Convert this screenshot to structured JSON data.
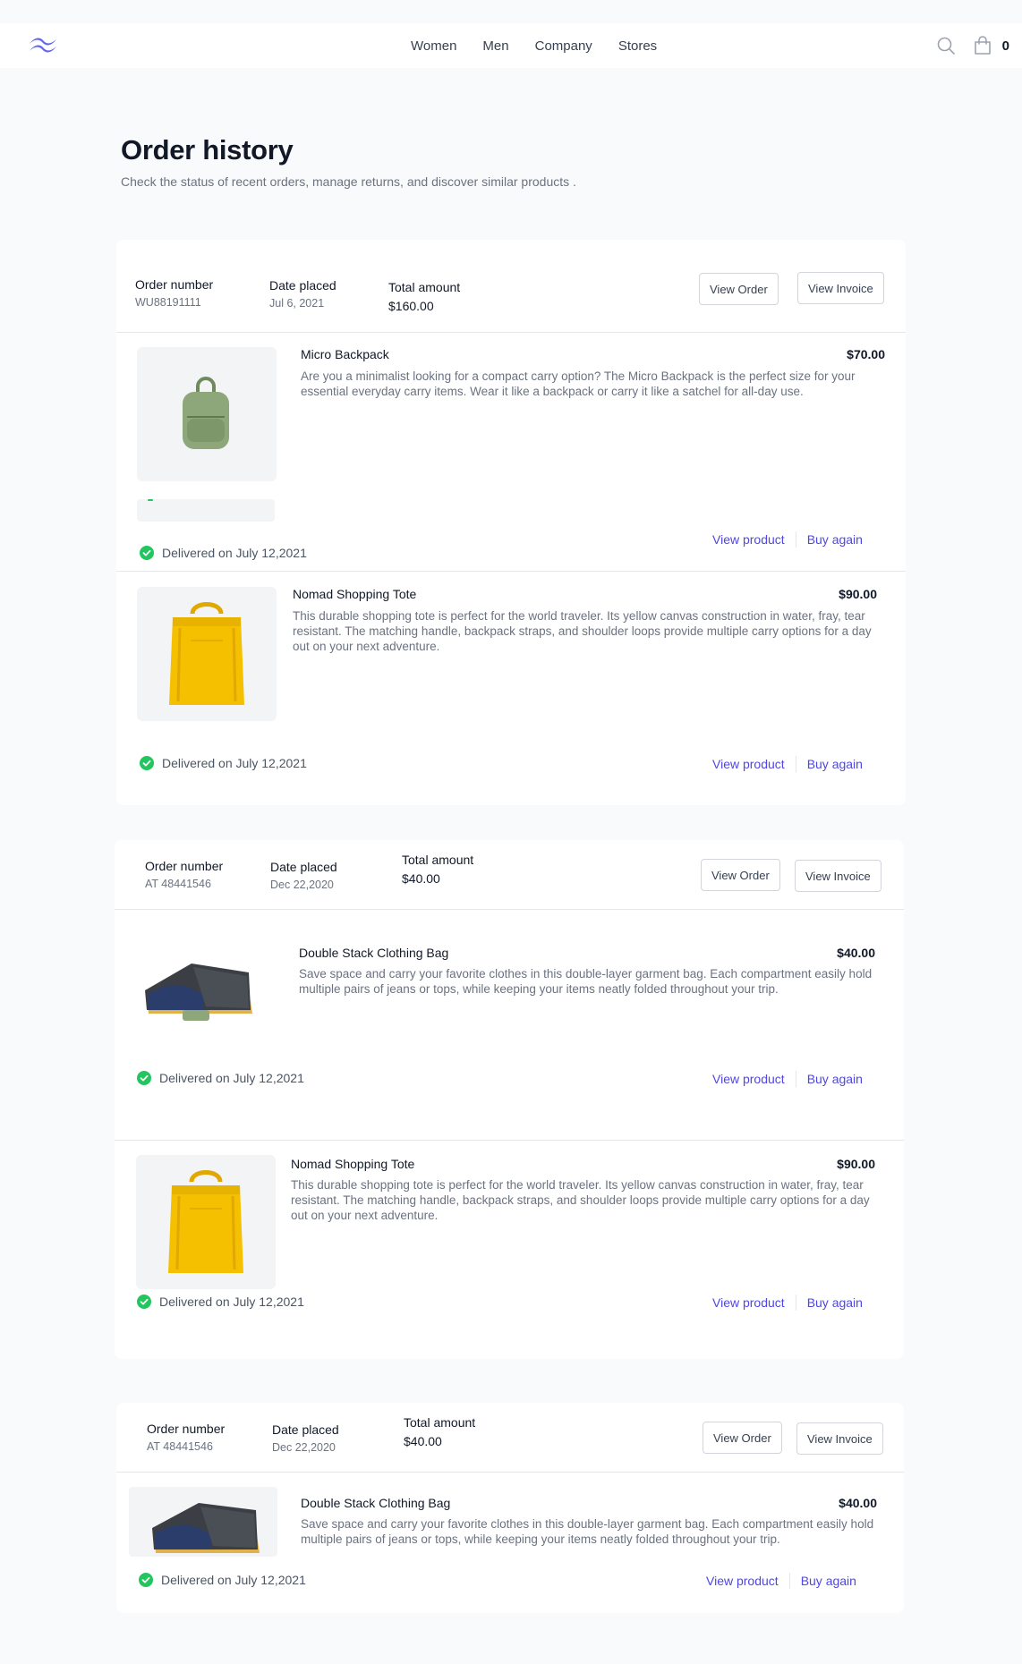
{
  "nav": {
    "links": [
      "Women",
      "Men",
      "Company",
      "Stores"
    ],
    "cart_count": "0"
  },
  "page": {
    "title": "Order history",
    "subtitle": "Check the status of recent orders, manage returns, and discover similar products ."
  },
  "labels": {
    "order_number": "Order number",
    "date_placed": "Date placed",
    "total_amount": "Total amount",
    "view_order": "View Order",
    "view_invoice": "View Invoice",
    "view_product": "View product",
    "buy_again": "Buy again"
  },
  "orders": [
    {
      "number": "WU88191111",
      "date": "Jul 6, 2021",
      "total": "$160.00",
      "items": [
        {
          "name": "Micro Backpack",
          "price": "$70.00",
          "description": "Are you a minimalist looking for a compact carry option? The Micro Backpack is the perfect size for your essential everyday carry items. Wear it like a backpack or carry it like a satchel for all-day use.",
          "status": "Delivered on July 12,2021",
          "image_icon": "green-backpack",
          "delivery_progress": 0.05
        },
        {
          "name": "Nomad Shopping Tote",
          "price": "$90.00",
          "description": "This durable shopping tote is perfect for the world traveler. Its yellow canvas construction in water, fray, tear resistant. The matching handle, backpack straps, and shoulder loops provide multiple carry options for a day out on your next adventure.",
          "status": "Delivered on July 12,2021",
          "image_icon": "yellow-tote"
        }
      ]
    },
    {
      "number": "AT 48441546",
      "date": "Dec 22,2020",
      "total": "$40.00",
      "items": [
        {
          "name": "Double Stack Clothing Bag",
          "price": "$40.00",
          "description": "Save space and carry your favorite clothes in this double-layer garment bag. Each compartment easily hold multiple pairs of jeans or tops, while keeping your items neatly folded throughout your trip.",
          "status": "Delivered on July 12,2021",
          "image_icon": "clothing-bag"
        },
        {
          "name": "Nomad Shopping Tote",
          "price": "$90.00",
          "description": "This durable shopping tote is perfect for the world traveler. Its yellow canvas construction in water, fray, tear resistant. The matching handle, backpack straps, and shoulder loops provide multiple carry options for a day out on your next adventure.",
          "status": "Delivered on July 12,2021",
          "image_icon": "yellow-tote"
        }
      ]
    },
    {
      "number": "AT 48441546",
      "date": "Dec 22,2020",
      "total": "$40.00",
      "items": [
        {
          "name": "Double Stack Clothing Bag",
          "price": "$40.00",
          "description": "Save space and carry your favorite clothes in this double-layer garment bag. Each compartment easily hold multiple pairs of jeans or tops, while keeping your items neatly folded throughout your trip.",
          "status": "Delivered on July 12,2021",
          "image_icon": "clothing-bag"
        }
      ]
    }
  ],
  "colors": {
    "accent": "#4f46e5",
    "success": "#22c55e",
    "logo": "#6366f1"
  }
}
